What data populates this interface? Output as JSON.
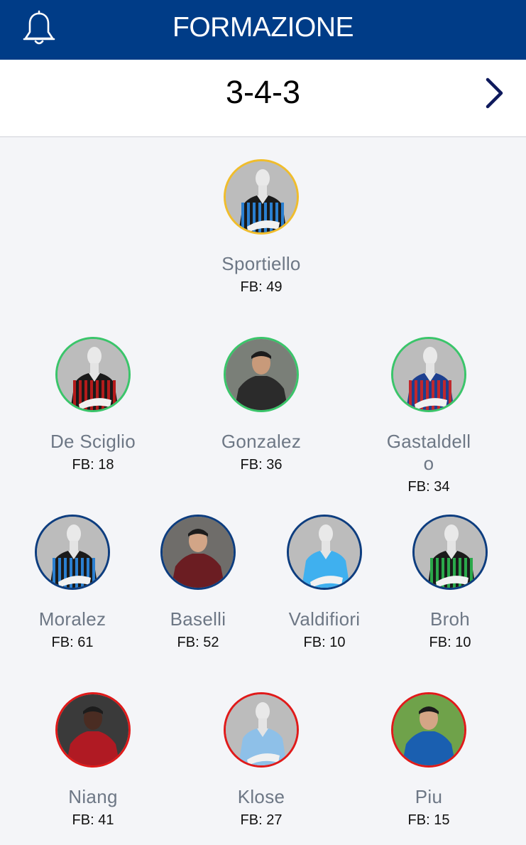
{
  "header": {
    "title": "FORMAZIONE",
    "bell_icon": "bell-icon",
    "background": "#003c87"
  },
  "module": {
    "value": "3-4-3",
    "next_icon": "chevron-right-icon"
  },
  "roles": {
    "goalkeeper": "#f0bd2c",
    "defender": "#3ac56a",
    "midfielder": "#0d3d7f",
    "forward": "#e01a1a"
  },
  "players": [
    {
      "name": "Sportiello",
      "fb": "FB: 49",
      "role": "goalkeeper",
      "kit": "black-blue-stripes"
    },
    {
      "name": "De Sciglio",
      "fb": "FB: 18",
      "role": "defender",
      "kit": "red-black-stripes"
    },
    {
      "name": "Gonzalez",
      "fb": "FB: 36",
      "role": "defender",
      "kit": "photo"
    },
    {
      "name": "Gastaldello",
      "fb": "FB: 34",
      "role": "defender",
      "kit": "red-blue-halves"
    },
    {
      "name": "Moralez",
      "fb": "FB: 61",
      "role": "midfielder",
      "kit": "black-blue-stripes"
    },
    {
      "name": "Baselli",
      "fb": "FB: 52",
      "role": "midfielder",
      "kit": "photo"
    },
    {
      "name": "Valdifiori",
      "fb": "FB: 10",
      "role": "midfielder",
      "kit": "sky-blue"
    },
    {
      "name": "Broh",
      "fb": "FB: 10",
      "role": "midfielder",
      "kit": "black-green-stripes"
    },
    {
      "name": "Niang",
      "fb": "FB: 41",
      "role": "forward",
      "kit": "photo"
    },
    {
      "name": "Klose",
      "fb": "FB: 27",
      "role": "forward",
      "kit": "light-blue"
    },
    {
      "name": "Piu",
      "fb": "FB: 15",
      "role": "forward",
      "kit": "photo"
    }
  ]
}
